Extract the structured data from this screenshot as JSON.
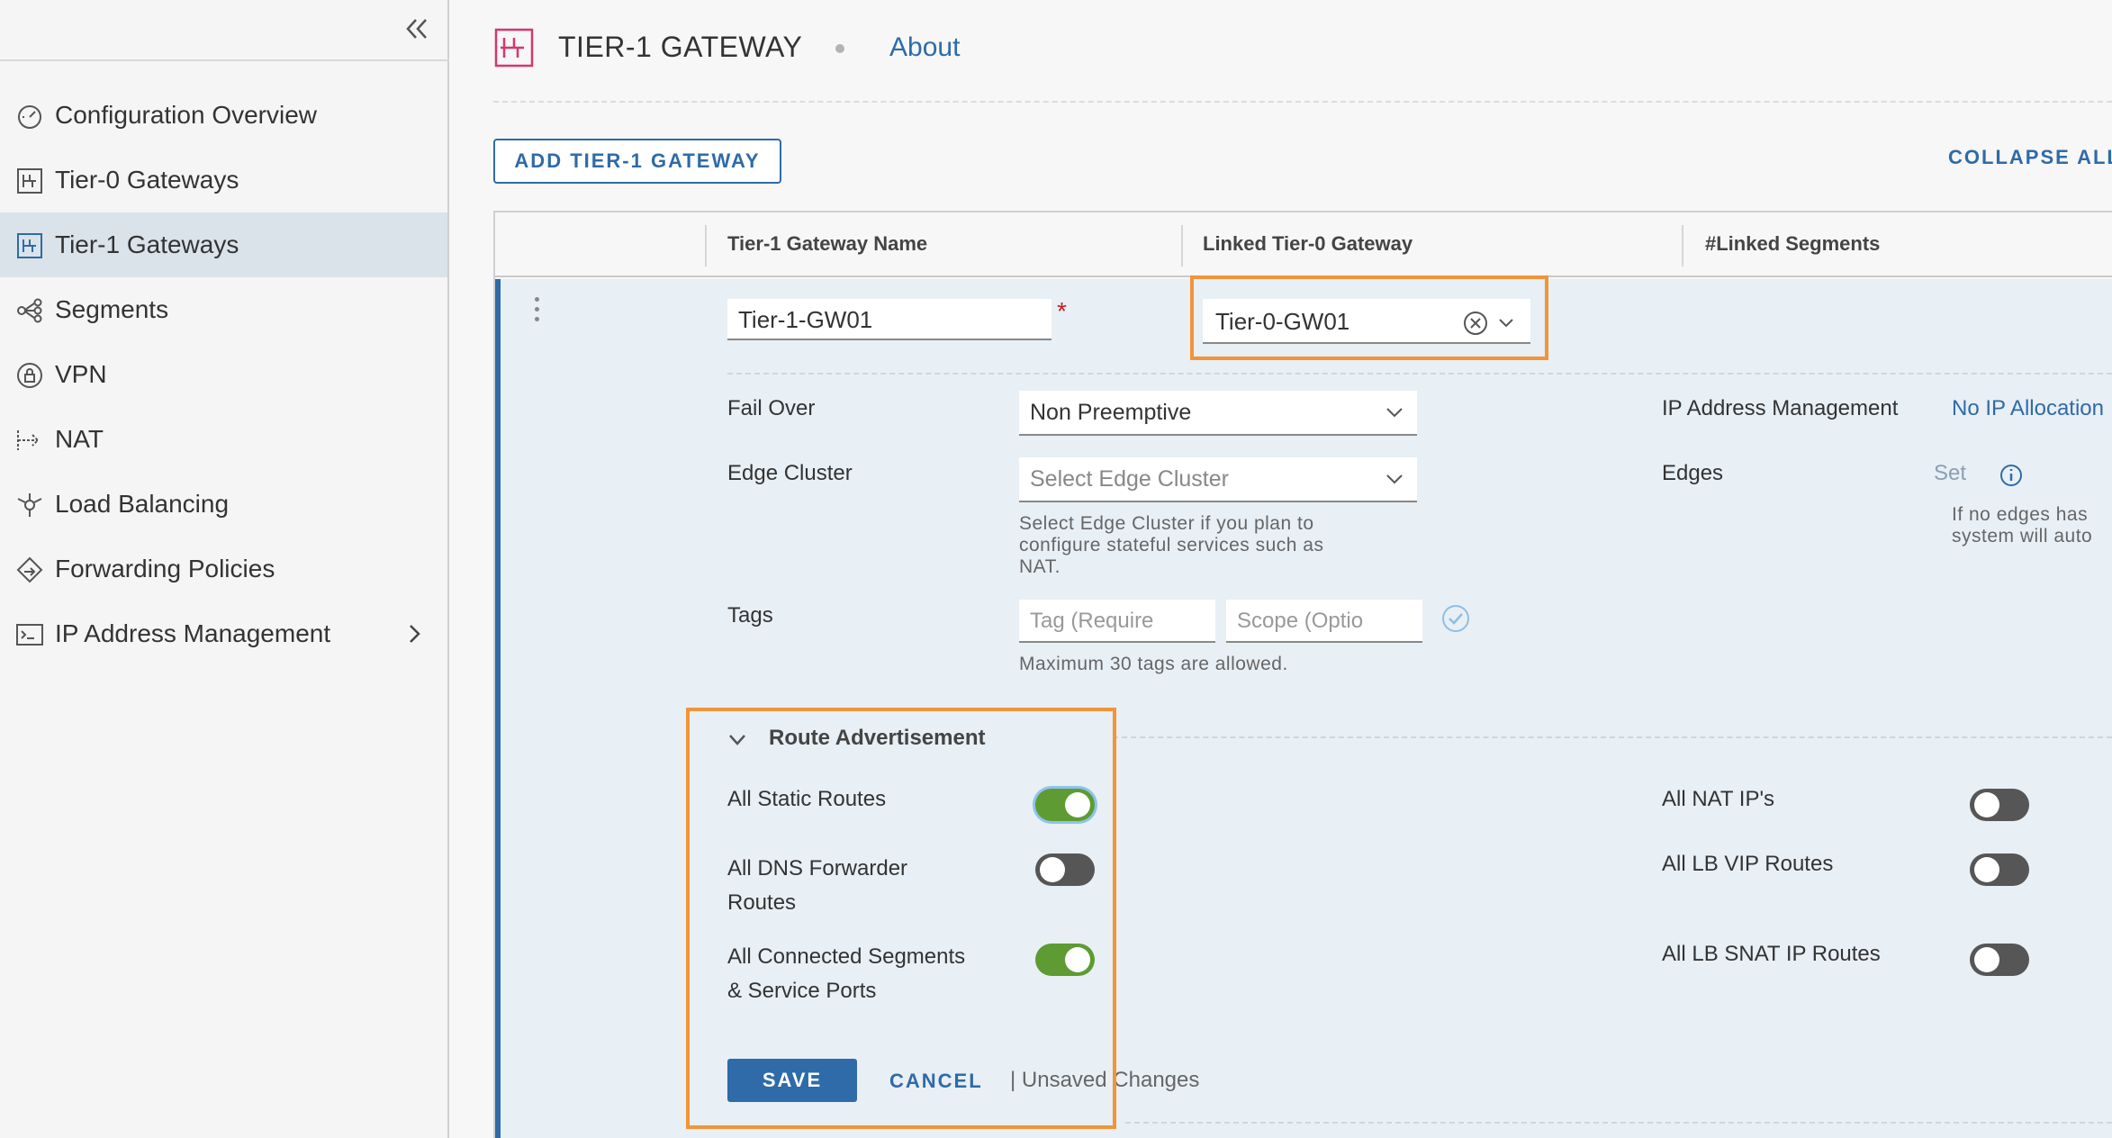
{
  "sidebar": {
    "items": [
      {
        "label": "Configuration Overview",
        "icon": "dashboard-gauge-icon"
      },
      {
        "label": "Tier-0 Gateways",
        "icon": "gateway-icon"
      },
      {
        "label": "Tier-1 Gateways",
        "icon": "gateway-icon",
        "active": true
      },
      {
        "label": "Segments",
        "icon": "segments-network-icon"
      },
      {
        "label": "VPN",
        "icon": "vpn-lock-icon"
      },
      {
        "label": "NAT",
        "icon": "nat-icon"
      },
      {
        "label": "Load Balancing",
        "icon": "load-balancer-icon"
      },
      {
        "label": "Forwarding Policies",
        "icon": "forwarding-policy-icon"
      },
      {
        "label": "IP Address Management",
        "icon": "ip-management-icon",
        "expandable": true
      }
    ]
  },
  "header": {
    "title": "TIER-1 GATEWAY",
    "about": "About",
    "add_button": "ADD TIER-1 GATEWAY",
    "collapse_all": "COLLAPSE ALL"
  },
  "table": {
    "columns": [
      "Tier-1 Gateway Name",
      "Linked Tier-0 Gateway",
      "#Linked Segments"
    ]
  },
  "form": {
    "name_value": "Tier-1-GW01",
    "required_mark": "*",
    "tier0_value": "Tier-0-GW01",
    "failover": {
      "label": "Fail Over",
      "value": "Non Preemptive"
    },
    "edge_cluster": {
      "label": "Edge Cluster",
      "placeholder": "Select Edge Cluster",
      "help_lines": [
        "Select Edge Cluster if you plan to",
        "configure stateful services such as",
        "NAT."
      ]
    },
    "ip_mgmt": {
      "label": "IP Address Management",
      "value": "No IP Allocation"
    },
    "edges": {
      "label": "Edges",
      "value": "Set",
      "help_lines": [
        "If no edges has",
        "system will auto"
      ]
    },
    "tags": {
      "label": "Tags",
      "tag_placeholder": "Tag (Require",
      "scope_placeholder": "Scope (Optio",
      "help": "Maximum 30 tags are allowed."
    }
  },
  "route_advertisement": {
    "title": "Route Advertisement",
    "left": [
      {
        "label_lines": [
          "All Static Routes"
        ],
        "on": true
      },
      {
        "label_lines": [
          "All DNS Forwarder",
          "Routes"
        ],
        "on": false
      },
      {
        "label_lines": [
          "All Connected Segments",
          "& Service Ports"
        ],
        "on": true
      }
    ],
    "right": [
      {
        "label": "All NAT IP's",
        "on": false
      },
      {
        "label": "All LB VIP Routes",
        "on": false
      },
      {
        "label": "All LB SNAT IP Routes",
        "on": false
      }
    ]
  },
  "actions": {
    "save": "SAVE",
    "cancel": "CANCEL",
    "unsaved": "| Unsaved Changes"
  },
  "colors": {
    "accent": "#2e6ba8",
    "highlight": "#f0953a",
    "toggle_on": "#5e9b32",
    "toggle_off": "#565656",
    "active_nav_bg": "#dae3ea"
  }
}
